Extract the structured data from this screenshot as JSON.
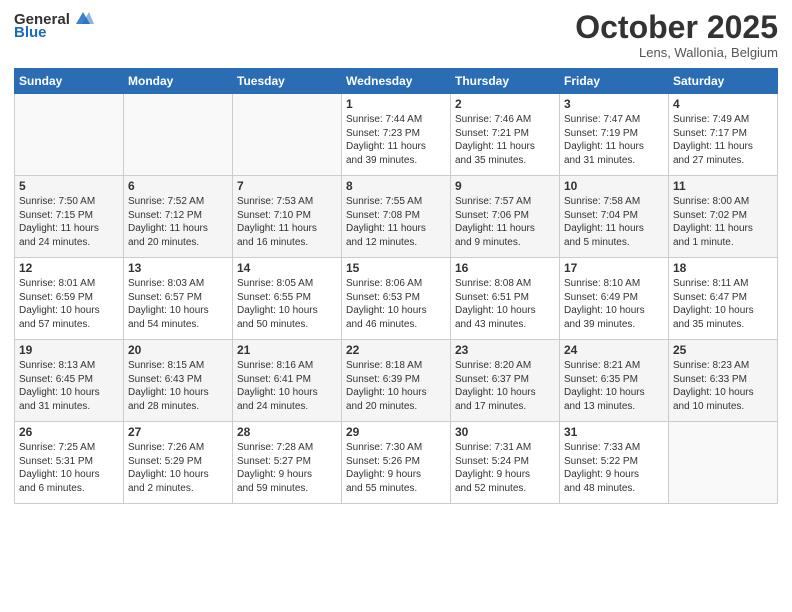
{
  "header": {
    "logo_general": "General",
    "logo_blue": "Blue",
    "month": "October 2025",
    "location": "Lens, Wallonia, Belgium"
  },
  "days_of_week": [
    "Sunday",
    "Monday",
    "Tuesday",
    "Wednesday",
    "Thursday",
    "Friday",
    "Saturday"
  ],
  "weeks": [
    [
      {
        "day": "",
        "info": ""
      },
      {
        "day": "",
        "info": ""
      },
      {
        "day": "",
        "info": ""
      },
      {
        "day": "1",
        "info": "Sunrise: 7:44 AM\nSunset: 7:23 PM\nDaylight: 11 hours\nand 39 minutes."
      },
      {
        "day": "2",
        "info": "Sunrise: 7:46 AM\nSunset: 7:21 PM\nDaylight: 11 hours\nand 35 minutes."
      },
      {
        "day": "3",
        "info": "Sunrise: 7:47 AM\nSunset: 7:19 PM\nDaylight: 11 hours\nand 31 minutes."
      },
      {
        "day": "4",
        "info": "Sunrise: 7:49 AM\nSunset: 7:17 PM\nDaylight: 11 hours\nand 27 minutes."
      }
    ],
    [
      {
        "day": "5",
        "info": "Sunrise: 7:50 AM\nSunset: 7:15 PM\nDaylight: 11 hours\nand 24 minutes."
      },
      {
        "day": "6",
        "info": "Sunrise: 7:52 AM\nSunset: 7:12 PM\nDaylight: 11 hours\nand 20 minutes."
      },
      {
        "day": "7",
        "info": "Sunrise: 7:53 AM\nSunset: 7:10 PM\nDaylight: 11 hours\nand 16 minutes."
      },
      {
        "day": "8",
        "info": "Sunrise: 7:55 AM\nSunset: 7:08 PM\nDaylight: 11 hours\nand 12 minutes."
      },
      {
        "day": "9",
        "info": "Sunrise: 7:57 AM\nSunset: 7:06 PM\nDaylight: 11 hours\nand 9 minutes."
      },
      {
        "day": "10",
        "info": "Sunrise: 7:58 AM\nSunset: 7:04 PM\nDaylight: 11 hours\nand 5 minutes."
      },
      {
        "day": "11",
        "info": "Sunrise: 8:00 AM\nSunset: 7:02 PM\nDaylight: 11 hours\nand 1 minute."
      }
    ],
    [
      {
        "day": "12",
        "info": "Sunrise: 8:01 AM\nSunset: 6:59 PM\nDaylight: 10 hours\nand 57 minutes."
      },
      {
        "day": "13",
        "info": "Sunrise: 8:03 AM\nSunset: 6:57 PM\nDaylight: 10 hours\nand 54 minutes."
      },
      {
        "day": "14",
        "info": "Sunrise: 8:05 AM\nSunset: 6:55 PM\nDaylight: 10 hours\nand 50 minutes."
      },
      {
        "day": "15",
        "info": "Sunrise: 8:06 AM\nSunset: 6:53 PM\nDaylight: 10 hours\nand 46 minutes."
      },
      {
        "day": "16",
        "info": "Sunrise: 8:08 AM\nSunset: 6:51 PM\nDaylight: 10 hours\nand 43 minutes."
      },
      {
        "day": "17",
        "info": "Sunrise: 8:10 AM\nSunset: 6:49 PM\nDaylight: 10 hours\nand 39 minutes."
      },
      {
        "day": "18",
        "info": "Sunrise: 8:11 AM\nSunset: 6:47 PM\nDaylight: 10 hours\nand 35 minutes."
      }
    ],
    [
      {
        "day": "19",
        "info": "Sunrise: 8:13 AM\nSunset: 6:45 PM\nDaylight: 10 hours\nand 31 minutes."
      },
      {
        "day": "20",
        "info": "Sunrise: 8:15 AM\nSunset: 6:43 PM\nDaylight: 10 hours\nand 28 minutes."
      },
      {
        "day": "21",
        "info": "Sunrise: 8:16 AM\nSunset: 6:41 PM\nDaylight: 10 hours\nand 24 minutes."
      },
      {
        "day": "22",
        "info": "Sunrise: 8:18 AM\nSunset: 6:39 PM\nDaylight: 10 hours\nand 20 minutes."
      },
      {
        "day": "23",
        "info": "Sunrise: 8:20 AM\nSunset: 6:37 PM\nDaylight: 10 hours\nand 17 minutes."
      },
      {
        "day": "24",
        "info": "Sunrise: 8:21 AM\nSunset: 6:35 PM\nDaylight: 10 hours\nand 13 minutes."
      },
      {
        "day": "25",
        "info": "Sunrise: 8:23 AM\nSunset: 6:33 PM\nDaylight: 10 hours\nand 10 minutes."
      }
    ],
    [
      {
        "day": "26",
        "info": "Sunrise: 7:25 AM\nSunset: 5:31 PM\nDaylight: 10 hours\nand 6 minutes."
      },
      {
        "day": "27",
        "info": "Sunrise: 7:26 AM\nSunset: 5:29 PM\nDaylight: 10 hours\nand 2 minutes."
      },
      {
        "day": "28",
        "info": "Sunrise: 7:28 AM\nSunset: 5:27 PM\nDaylight: 9 hours\nand 59 minutes."
      },
      {
        "day": "29",
        "info": "Sunrise: 7:30 AM\nSunset: 5:26 PM\nDaylight: 9 hours\nand 55 minutes."
      },
      {
        "day": "30",
        "info": "Sunrise: 7:31 AM\nSunset: 5:24 PM\nDaylight: 9 hours\nand 52 minutes."
      },
      {
        "day": "31",
        "info": "Sunrise: 7:33 AM\nSunset: 5:22 PM\nDaylight: 9 hours\nand 48 minutes."
      },
      {
        "day": "",
        "info": ""
      }
    ]
  ]
}
